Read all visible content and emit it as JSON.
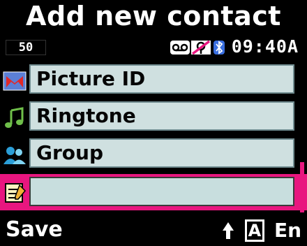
{
  "screen": {
    "title": "Add new contact"
  },
  "status_bar": {
    "signal_value": "50",
    "time": "09:40A",
    "icons": [
      "voicemail-icon",
      "no-location-icon",
      "bluetooth-icon"
    ]
  },
  "fields": [
    {
      "icon": "picture-icon",
      "label": "Picture ID"
    },
    {
      "icon": "music-note-icon",
      "label": "Ringtone"
    },
    {
      "icon": "people-icon",
      "label": "Group"
    },
    {
      "icon": "memo-icon",
      "label": ""
    }
  ],
  "softkeys": {
    "left": "Save",
    "case_indicator": "A",
    "language": "En"
  },
  "colors": {
    "accent": "#e8167f",
    "field_bg": "#cfe0e0"
  }
}
